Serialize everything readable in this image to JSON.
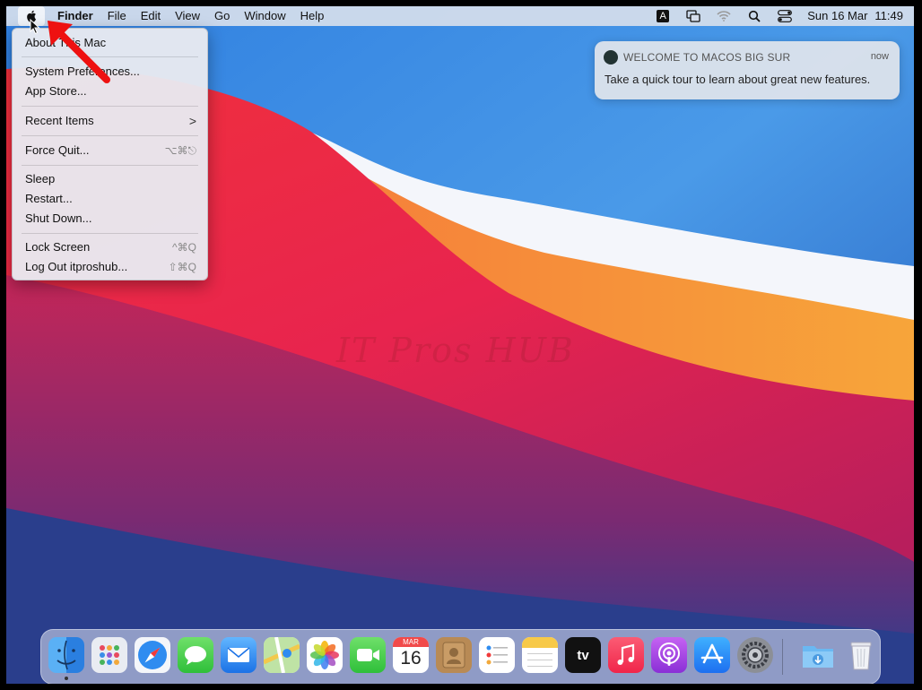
{
  "menubar": {
    "app_name": "Finder",
    "menus": [
      "File",
      "Edit",
      "View",
      "Go",
      "Window",
      "Help"
    ],
    "input_source": "A",
    "date": "Sun 16 Mar",
    "time": "11:49"
  },
  "apple_menu": {
    "items": [
      {
        "label": "About This Mac",
        "shortcut": ""
      },
      {
        "label": "System Preferences...",
        "shortcut": ""
      },
      {
        "label": "App Store...",
        "shortcut": ""
      },
      {
        "label": "Recent Items",
        "shortcut": ">"
      },
      {
        "label": "Force Quit...",
        "shortcut": "⌥⌘⎋"
      },
      {
        "label": "Sleep",
        "shortcut": ""
      },
      {
        "label": "Restart...",
        "shortcut": ""
      },
      {
        "label": "Shut Down...",
        "shortcut": ""
      },
      {
        "label": "Lock Screen",
        "shortcut": "^⌘Q"
      },
      {
        "label": "Log Out itproshub...",
        "shortcut": "⇧⌘Q"
      }
    ]
  },
  "notification": {
    "title": "WELCOME TO MACOS BIG SUR",
    "time": "now",
    "body": "Take a quick tour to learn about great new features."
  },
  "watermark": "IT Pros HUB",
  "dock": {
    "items": [
      "finder-icon",
      "launchpad-icon",
      "safari-icon",
      "messages-icon",
      "mail-icon",
      "maps-icon",
      "photos-icon",
      "facetime-icon",
      "calendar-icon",
      "contacts-icon",
      "reminders-icon",
      "notes-icon",
      "apple-tv-icon",
      "music-icon",
      "podcasts-icon",
      "app-store-icon",
      "system-preferences-icon",
      "downloads-folder-icon",
      "trash-icon"
    ],
    "calendar_month": "MAR",
    "calendar_day": "16",
    "tv_label": "tv"
  }
}
